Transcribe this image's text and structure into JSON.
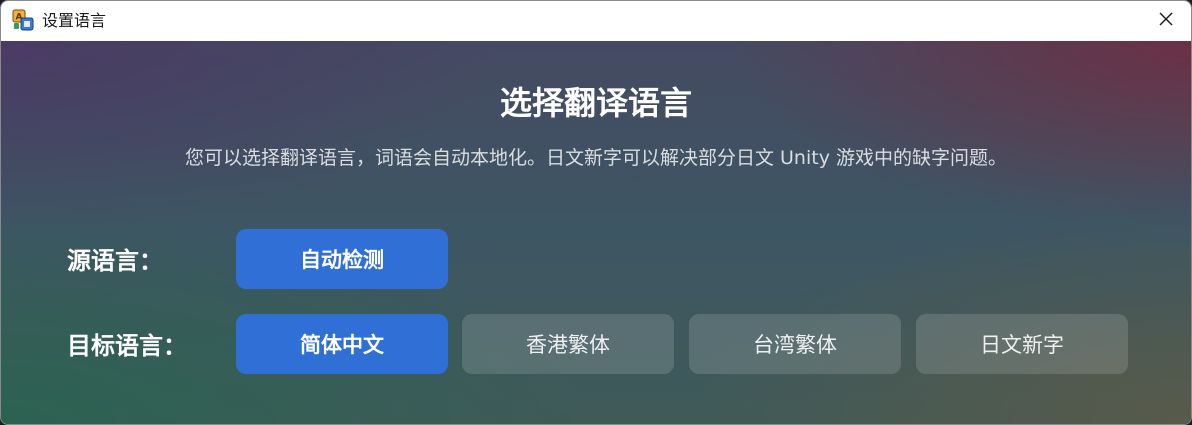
{
  "window": {
    "title": "设置语言"
  },
  "main": {
    "heading": "选择翻译语言",
    "description": "您可以选择翻译语言，词语会自动本地化。日文新字可以解决部分日文 Unity 游戏中的缺字问题。"
  },
  "source_language": {
    "label": "源语言：",
    "options": [
      {
        "label": "自动检测",
        "selected": true
      }
    ]
  },
  "target_language": {
    "label": "目标语言：",
    "options": [
      {
        "label": "简体中文",
        "selected": true
      },
      {
        "label": "香港繁体",
        "selected": false
      },
      {
        "label": "台湾繁体",
        "selected": false
      },
      {
        "label": "日文新字",
        "selected": false
      }
    ]
  },
  "colors": {
    "accent": "#2f6fd6",
    "unselected_button": "rgba(255,255,255,0.14)"
  },
  "icons": {
    "app": "translate-app-icon",
    "close": "close-icon"
  }
}
